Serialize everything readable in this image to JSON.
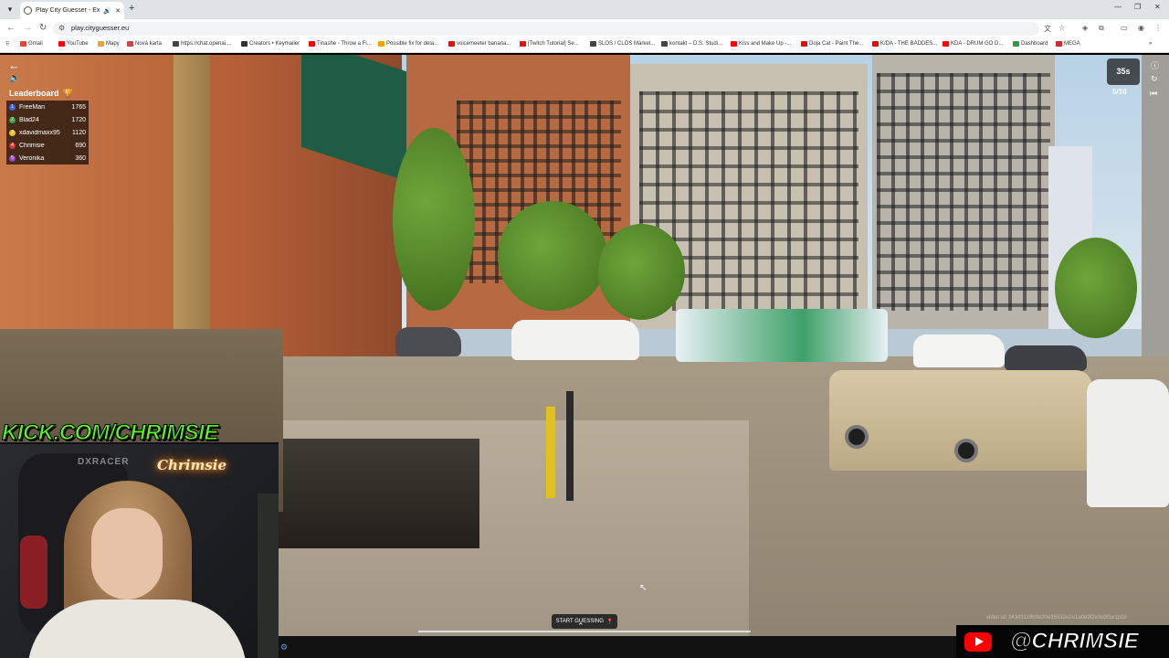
{
  "browser": {
    "tab_title": "Play City Guesser - Explore",
    "url": "play.cityguesser.eu",
    "bookmarks": [
      {
        "label": "Gmail",
        "color": "#ea4335"
      },
      {
        "label": "YouTube",
        "color": "#ff0000"
      },
      {
        "label": "Mapy",
        "color": "#e8a33d"
      },
      {
        "label": "Nová karta",
        "color": "#e23b3b"
      },
      {
        "label": "https://chat.openai....",
        "color": "#444444"
      },
      {
        "label": "Creators • Keymailer",
        "color": "#333333"
      },
      {
        "label": "Tinashe - Throw a Fi...",
        "color": "#ff0000"
      },
      {
        "label": "Possible fix for dela...",
        "color": "#f0a500"
      },
      {
        "label": "voicemeeter banana...",
        "color": "#ff0000"
      },
      {
        "label": "[Twitch Tutorial] Se...",
        "color": "#ff0000"
      },
      {
        "label": "SLOS / CLOS Market...",
        "color": "#444444"
      },
      {
        "label": "kontakt – D.S. Studi...",
        "color": "#444444"
      },
      {
        "label": "Kiss and Make Up -...",
        "color": "#ff0000"
      },
      {
        "label": "Doja Cat - Paint The...",
        "color": "#ff0000"
      },
      {
        "label": "K/DA - THE BADDES...",
        "color": "#ff0000"
      },
      {
        "label": "KDA - DRUM GO D...",
        "color": "#ff0000"
      },
      {
        "label": "Dashboard",
        "color": "#2e9e44"
      },
      {
        "label": "MEGA",
        "color": "#d9272e"
      }
    ]
  },
  "game": {
    "leaderboard_title": "Leaderboard",
    "leaderboard": [
      {
        "rank": "1",
        "name": "FreeMan",
        "points": "1765",
        "color": "#3c6be0"
      },
      {
        "rank": "2",
        "name": "Blad24",
        "points": "1720",
        "color": "#3fa34d"
      },
      {
        "rank": "3",
        "name": "xdavidmaxx95",
        "points": "1120",
        "color": "#e5c21c"
      },
      {
        "rank": "4",
        "name": "Chrimsie",
        "points": "690",
        "color": "#d9363e"
      },
      {
        "rank": "5",
        "name": "Veronika",
        "points": "360",
        "color": "#9b46c9"
      }
    ],
    "timer": "35s",
    "round": "5/10",
    "start_button": "START GUESSING",
    "video_id": "video id: 34343119b9e30e35532e2e1a0e9f2e3d3f1e1p1b"
  },
  "overlay": {
    "kick_text": "KICK.COM/CHRIMSIE",
    "neon_sign": "Chrimsie",
    "chair_brand": "DXRACER",
    "youtube_handle": "@CHRIMSIE"
  }
}
